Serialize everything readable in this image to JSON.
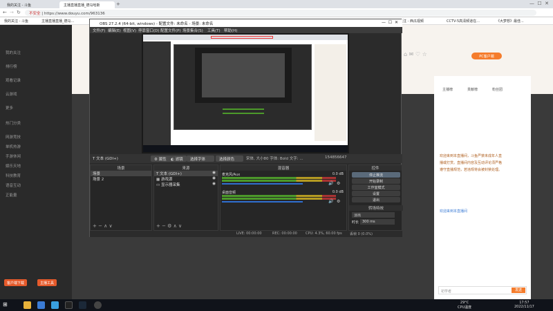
{
  "browser": {
    "tabs": [
      {
        "label": "我的关注 - 斗鱼"
      },
      {
        "label": "主播直播直播_德马哈斯"
      }
    ],
    "security_label": "不安全",
    "url": "https://www.douyu.com/963136",
    "bookmarks": [
      {
        "label": "我的关注 - 斗鱼"
      },
      {
        "label": "主播直播直播_德马..."
      },
      {
        "label": "我的关注 - 西瓜视频"
      },
      {
        "label": "CCTV-5高清频道在..."
      },
      {
        "label": "《大梦想》最佳..."
      }
    ]
  },
  "site": {
    "sidebar_items": [
      {
        "label": "我的关注"
      },
      {
        "label": "排行榜"
      },
      {
        "label": "观看记录"
      },
      {
        "label": "云游戏"
      },
      {
        "label": "更多"
      },
      {
        "label": "热门分类"
      },
      {
        "label": "网游竞技"
      },
      {
        "label": "单机热游"
      },
      {
        "label": "手游休闲"
      },
      {
        "label": "娱乐天地"
      },
      {
        "label": "科技教育"
      },
      {
        "label": "语音互动"
      },
      {
        "label": "正能量"
      }
    ],
    "sidebar_buttons": [
      {
        "label": "客户端下载"
      },
      {
        "label": "主播工具"
      }
    ],
    "tab_labels": [
      {
        "label": "主播榜"
      },
      {
        "label": "贡献榜"
      },
      {
        "label": "粉丝团"
      }
    ],
    "chat_lines": [
      {
        "label": "欢迎来到本直播间，斗鱼严禁未成年人直"
      },
      {
        "label": "播或打赏。直播间内容及互动评论须严格"
      },
      {
        "label": "遵守直播规范，若违规将会被封禁处理。"
      },
      {
        "label": "欢迎来到本直播间"
      }
    ],
    "pc_button": "PC客户端",
    "send_hint": "发送",
    "gift_hint": "初学者"
  },
  "obs": {
    "title": "OBS 27.2.4 (64-bit, windows) - 配置文件: 未命名 - 场景: 未命名",
    "menu": [
      {
        "label": "文件(F)"
      },
      {
        "label": "编辑(E)"
      },
      {
        "label": "视图(V)"
      },
      {
        "label": "停靠窗口(D)"
      },
      {
        "label": "配置文件(P)"
      },
      {
        "label": "场景集合(S)"
      },
      {
        "label": "工具(T)"
      },
      {
        "label": "帮助(H)"
      }
    ],
    "source_toolbar": {
      "selected_source": "文本 (GDI+)",
      "properties": "属性",
      "filters": "滤镜",
      "font_button": "选择字体",
      "color_button": "选择颜色",
      "font_info": "宋体, 大小80 字体: Bold 文字: ...",
      "text_value": "154856647"
    },
    "scenes": {
      "title": "场景",
      "items": [
        {
          "label": "场景"
        },
        {
          "label": "场景 2"
        }
      ]
    },
    "sources": {
      "title": "来源",
      "items": [
        {
          "label": "文本 (GDI+)"
        },
        {
          "label": "游戏源"
        },
        {
          "label": "显示器采集"
        }
      ]
    },
    "mixer": {
      "title": "混音器",
      "channels": [
        {
          "name": "麦克风/Aux",
          "db": "0.0 dB",
          "level": 0.78
        },
        {
          "name": "桌面音频",
          "db": "0.0 dB",
          "level": 0.78
        }
      ]
    },
    "controls": {
      "title": "控件",
      "buttons": [
        {
          "label": "停止推流"
        },
        {
          "label": "开始录制"
        },
        {
          "label": "工作室模式"
        },
        {
          "label": "设置"
        },
        {
          "label": "退出"
        }
      ]
    },
    "transitions": {
      "title": "转场特效",
      "selected": "淡出",
      "duration_label": "时长",
      "duration_value": "300 ms"
    },
    "status": {
      "live": "LIVE: 00:00:00",
      "rec": "REC: 00:00:00",
      "cpu": "CPU: 4.3%, 60.00 fps",
      "dropped": "丢帧 0 (0.0%)"
    }
  },
  "taskbar": {
    "weather": "29°C",
    "weather_sub": "CPU温度",
    "time": "17:57",
    "date": "2022/11/17"
  },
  "colors": {
    "obs_bg": "#2b2b2b",
    "accent_orange": "#f57c2c",
    "meter_green": "#4c9a2a"
  }
}
